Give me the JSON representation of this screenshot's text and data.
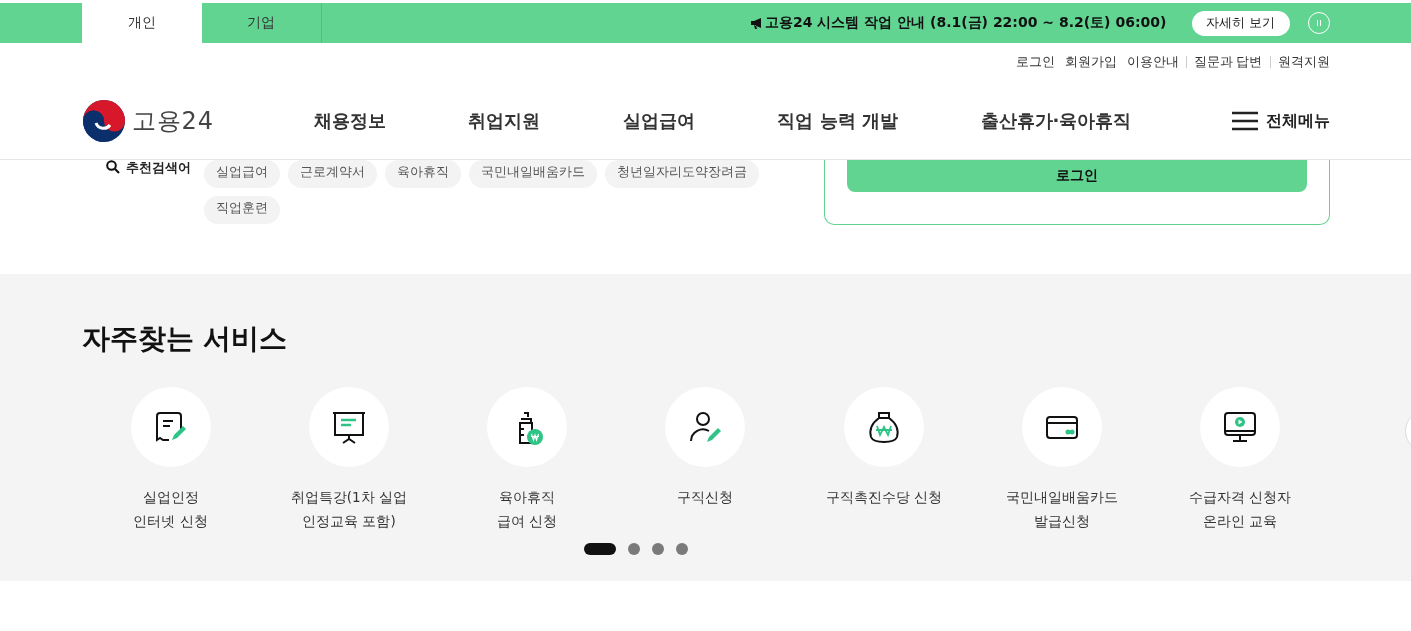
{
  "top_bar": {
    "tabs": [
      {
        "label": "개인",
        "selected": true
      },
      {
        "label": "기업",
        "selected": false
      }
    ],
    "notice": "고용24 시스템 작업 안내 (8.1(금) 22:00 ~ 8.2(토) 06:00)",
    "detail_button": "자세히 보기"
  },
  "utility_links": [
    {
      "label": "로그인",
      "divider": false
    },
    {
      "label": "회원가입",
      "divider": false
    },
    {
      "label": "이용안내",
      "divider": false
    },
    {
      "label": "질문과 답변",
      "divider": true
    },
    {
      "label": "원격지원",
      "divider": true
    }
  ],
  "header": {
    "logo": "고용24",
    "nav": [
      "채용정보",
      "취업지원",
      "실업급여",
      "직업 능력 개발",
      "출산휴가·육아휴직"
    ],
    "all_menu": "전체메뉴"
  },
  "search": {
    "label": "추천검색어",
    "keywords": [
      "실업급여",
      "근로계약서",
      "육아휴직",
      "국민내일배움카드",
      "청년일자리도약장려금",
      "직업훈련"
    ]
  },
  "login_card": {
    "button": "로그인"
  },
  "services": {
    "title": "자주찾는 서비스",
    "items": [
      {
        "kind": "document-pen",
        "lines": [
          "실업인정",
          "인터넷 신청"
        ]
      },
      {
        "kind": "presentation",
        "lines": [
          "취업특강(1차 실업",
          "인정교육 포함)"
        ]
      },
      {
        "kind": "bottle-won",
        "lines": [
          "육아휴직",
          "급여 신청"
        ]
      },
      {
        "kind": "person-pen",
        "lines": [
          "구직신청"
        ]
      },
      {
        "kind": "money-bag",
        "lines": [
          "구직촉진수당 신청"
        ]
      },
      {
        "kind": "card",
        "lines": [
          "국민내일배움카드",
          "발급신청"
        ]
      },
      {
        "kind": "monitor-play",
        "lines": [
          "수급자격 신청자",
          "온라인 교육"
        ]
      }
    ],
    "pager": [
      {
        "selected": true
      },
      {
        "selected": false
      },
      {
        "selected": false
      },
      {
        "selected": false
      }
    ]
  }
}
